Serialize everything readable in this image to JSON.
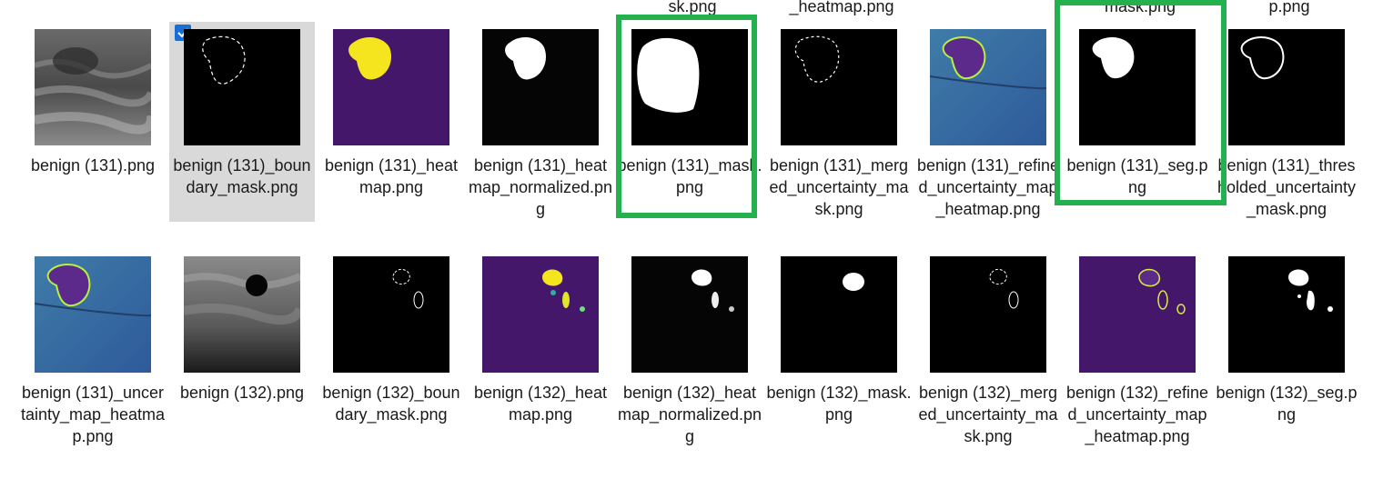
{
  "top_row_partial_labels": [
    {
      "id": "t1",
      "text": "sk.png"
    },
    {
      "id": "t2",
      "text": "_heatmap.png"
    },
    {
      "id": "t3",
      "text": "mask.png"
    },
    {
      "id": "t4",
      "text": "p.png"
    }
  ],
  "row1": [
    {
      "label": "benign (131).png",
      "thumb": "ultrasound"
    },
    {
      "label": "benign (131)_boundary_mask.png",
      "thumb": "boundary",
      "selected": true
    },
    {
      "label": "benign (131)_heatmap.png",
      "thumb": "heatmap"
    },
    {
      "label": "benign (131)_heatmap_normalized.png",
      "thumb": "heatmap-normalized"
    },
    {
      "label": "benign (131)_mask.png",
      "thumb": "mask"
    },
    {
      "label": "benign (131)_merged_uncertainty_mask.png",
      "thumb": "merged-uncertainty"
    },
    {
      "label": "benign (131)_refined_uncertainty_map_heatmap.png",
      "thumb": "refined-uncertainty"
    },
    {
      "label": "benign (131)_seg.png",
      "thumb": "seg"
    },
    {
      "label": "benign (131)_thresholded_uncertainty_mask.png",
      "thumb": "thresholded-uncertainty"
    }
  ],
  "row2": [
    {
      "label": "benign (131)_uncertainty_map_heatmap.png",
      "thumb": "uncertainty-heatmap"
    },
    {
      "label": "benign (132).png",
      "thumb": "ultrasound-2"
    },
    {
      "label": "benign (132)_boundary_mask.png",
      "thumb": "boundary-2"
    },
    {
      "label": "benign (132)_heatmap.png",
      "thumb": "heatmap-2"
    },
    {
      "label": "benign (132)_heatmap_normalized.png",
      "thumb": "heatmap-normalized-2"
    },
    {
      "label": "benign (132)_mask.png",
      "thumb": "mask-2"
    },
    {
      "label": "benign (132)_merged_uncertainty_mask.png",
      "thumb": "merged-uncertainty-2"
    },
    {
      "label": "benign (132)_refined_uncertainty_map_heatmap.png",
      "thumb": "refined-uncertainty-2"
    },
    {
      "label": "benign (132)_seg.png",
      "thumb": "seg-2"
    }
  ],
  "selection_check_icon": "checkmark-icon",
  "highlight_color": "#22b14c",
  "selected_bg": "#d9d9d9",
  "checkbox_color": "#1a6fd6"
}
